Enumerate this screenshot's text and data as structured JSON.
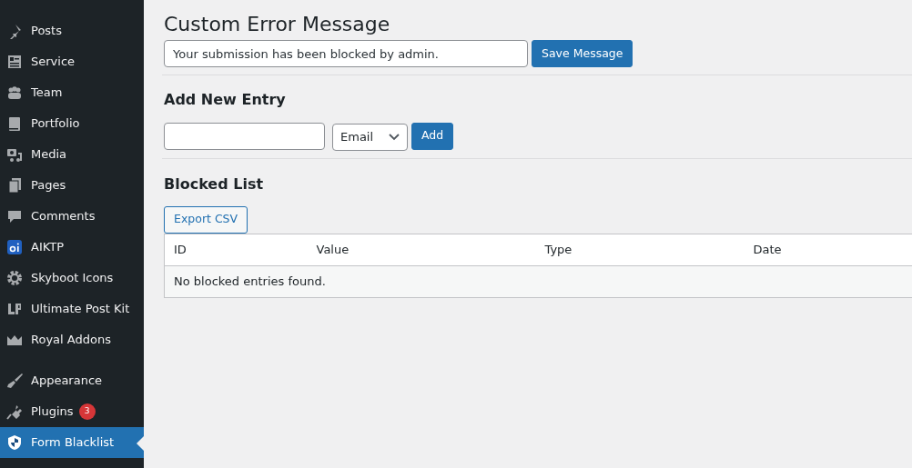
{
  "sidebar": {
    "groups": [
      {
        "items": [
          {
            "label": "Posts",
            "selected": false
          },
          {
            "label": "Service",
            "selected": false
          },
          {
            "label": "Team",
            "selected": false
          },
          {
            "label": "Portfolio",
            "selected": false
          },
          {
            "label": "Media",
            "selected": false
          },
          {
            "label": "Pages",
            "selected": false
          },
          {
            "label": "Comments",
            "selected": false
          },
          {
            "label": "AIKTP",
            "selected": false
          },
          {
            "label": "Skyboot Icons",
            "selected": false
          },
          {
            "label": "Ultimate Post Kit",
            "selected": false
          },
          {
            "label": "Royal Addons",
            "selected": false
          }
        ]
      },
      {
        "items": [
          {
            "label": "Appearance",
            "selected": false
          },
          {
            "label": "Plugins",
            "selected": false,
            "badge": "3"
          },
          {
            "label": "Form Blacklist",
            "selected": true
          }
        ]
      }
    ]
  },
  "message_section": {
    "title": "Custom Error Message",
    "value": "Your submission has been blocked by admin.",
    "button": "Save Message"
  },
  "add_section": {
    "title": "Add New Entry",
    "type_select": "Email",
    "button": "Add"
  },
  "blocked_section": {
    "title": "Blocked List",
    "export_button": "Export CSV",
    "table": {
      "columns": [
        "ID",
        "Value",
        "Type",
        "Date"
      ],
      "empty_message": "No blocked entries found."
    }
  }
}
